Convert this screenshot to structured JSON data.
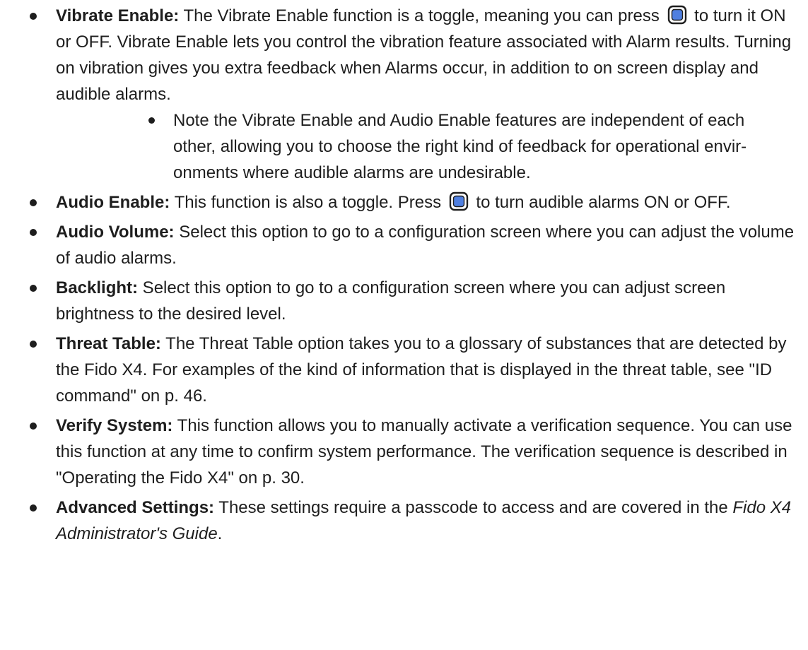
{
  "items": [
    {
      "term": "Vibrate Enable:",
      "text_a": " The Vibrate Enable function is a toggle, meaning you can press ",
      "text_b": " to turn it ON or OFF. Vibrate Enable lets you control the vibration feature associated with Alarm results. Turning on vibration gives you extra feedback when Alarms occur, in addition to on screen display and audible alarms.",
      "sub": "Note the Vibrate Enable and Audio Enable features are independent of each other, allowing you to choose the right kind of feedback for operational envir-onments where audible alarms are undesirable."
    },
    {
      "term": "Audio Enable:",
      "text_a": " This function is also a toggle. Press ",
      "text_b": " to turn audible alarms ON or OFF."
    },
    {
      "term": "Audio Volume:",
      "text": " Select this option to go to a configuration screen where you can adjust the volume of audio alarms."
    },
    {
      "term": "Backlight:",
      "text": " Select this option to go to a configuration screen where you can adjust screen brightness to the desired level."
    },
    {
      "term": "Threat Table:",
      "text": " The Threat Table option takes you to a glossary of substances that are detected by the Fido X4. For examples of the kind of information that is displayed in the threat table, see \"ID command\" on p. 46."
    },
    {
      "term": "Verify System:",
      "text": " This function allows you to manually activate a verification sequence. You can use this function at any time to confirm system performance. The verification sequence is described in \"Operating the Fido X4\" on p. 30."
    },
    {
      "term": "Advanced Settings:",
      "text": " These settings require a passcode to access and are covered in the ",
      "italic": "Fido X4 Administrator's Guide",
      "tail": "."
    }
  ],
  "icons": {
    "select_button": "select-button-icon",
    "button_fill": "#4f7fe0",
    "button_border": "#1e1e1e"
  }
}
